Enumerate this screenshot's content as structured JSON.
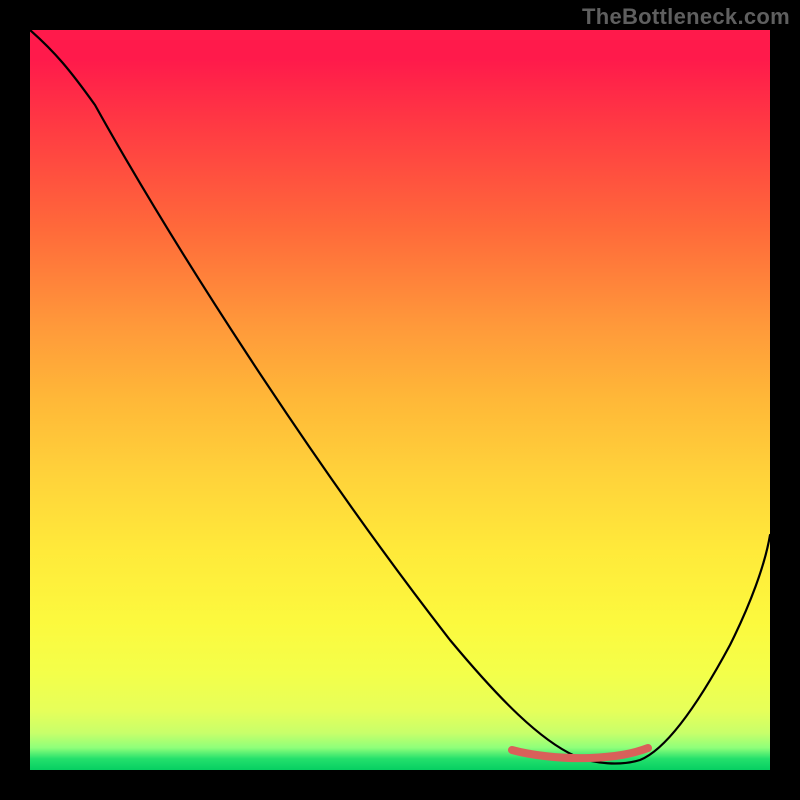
{
  "watermark": "TheBottleneck.com",
  "chart_data": {
    "type": "line",
    "title": "",
    "xlabel": "",
    "ylabel": "",
    "xlim": [
      0,
      100
    ],
    "ylim": [
      0,
      100
    ],
    "series": [
      {
        "name": "bottleneck-curve",
        "x": [
          0,
          6,
          12,
          20,
          30,
          40,
          50,
          58,
          63,
          67,
          70,
          73,
          77,
          80,
          83,
          85,
          88,
          92,
          96,
          100
        ],
        "y": [
          100,
          96,
          90,
          80,
          66,
          53,
          39,
          28,
          20,
          14,
          9,
          5,
          2,
          1,
          1,
          2,
          5,
          12,
          22,
          34
        ]
      },
      {
        "name": "optimal-band",
        "x": [
          65,
          68,
          71,
          74,
          77,
          79,
          81,
          83
        ],
        "y": [
          3.0,
          2.4,
          2.0,
          2.0,
          2.2,
          2.4,
          2.8,
          3.2
        ]
      }
    ],
    "highlight": {
      "from_x": 65,
      "to_x": 83
    },
    "background_gradient": {
      "stops": [
        {
          "pct": 0,
          "color": "#ff1a4b"
        },
        {
          "pct": 50,
          "color": "#ffb838"
        },
        {
          "pct": 85,
          "color": "#f3ff4a"
        },
        {
          "pct": 100,
          "color": "#06cf62"
        }
      ]
    }
  }
}
